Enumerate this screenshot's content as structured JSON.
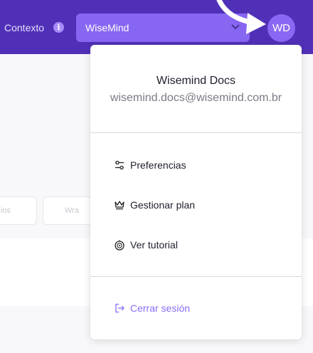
{
  "topbar": {
    "context_label": "Contexto",
    "info_icon_glyph": "i",
    "context_value": "WiseMind",
    "avatar_initials": "WD"
  },
  "background": {
    "chips": [
      "ios",
      "Wra"
    ]
  },
  "account_menu": {
    "name": "Wisemind Docs",
    "email": "wisemind.docs@wisemind.com.br",
    "items": [
      {
        "label": "Preferencias",
        "icon": "sliders-icon"
      },
      {
        "label": "Gestionar plan",
        "icon": "crown-icon"
      },
      {
        "label": "Ver tutorial",
        "icon": "compass-icon"
      }
    ],
    "logout": {
      "label": "Cerrar sesión",
      "icon": "logout-icon"
    }
  },
  "colors": {
    "topbar": "#5130b8",
    "select": "#8766f2",
    "avatar": "#8b68f3",
    "accent": "#8b6df3"
  }
}
